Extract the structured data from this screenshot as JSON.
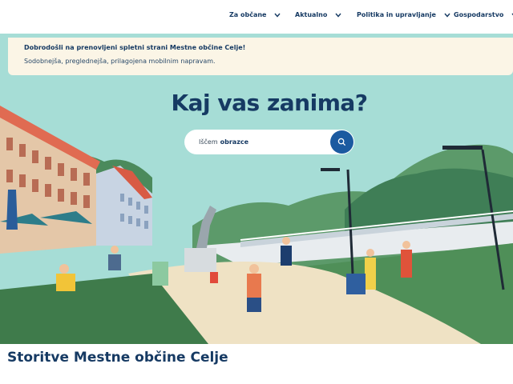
{
  "nav": {
    "items": [
      {
        "label": "Za občane"
      },
      {
        "label": "Aktualno"
      },
      {
        "label": "Politika in upravljanje"
      },
      {
        "label": "Gospodarstvo"
      }
    ]
  },
  "notice": {
    "title": "Dobrodošli na prenovljeni spletni strani Mestne občine Celje!",
    "text": "Sodobnejša, preglednejša, prilagojena mobilnim napravam."
  },
  "hero": {
    "headline": "Kaj vas zanima?"
  },
  "search": {
    "prefix": "Iščem",
    "value": "obrazce",
    "button_icon": "search-icon"
  },
  "services": {
    "title": "Storitve Mestne občine Celje"
  },
  "colors": {
    "brand_navy": "#163a63",
    "accent_blue": "#1b5aa0",
    "notice_bg": "#fbf5e6",
    "sky": "#a6ddd6"
  }
}
